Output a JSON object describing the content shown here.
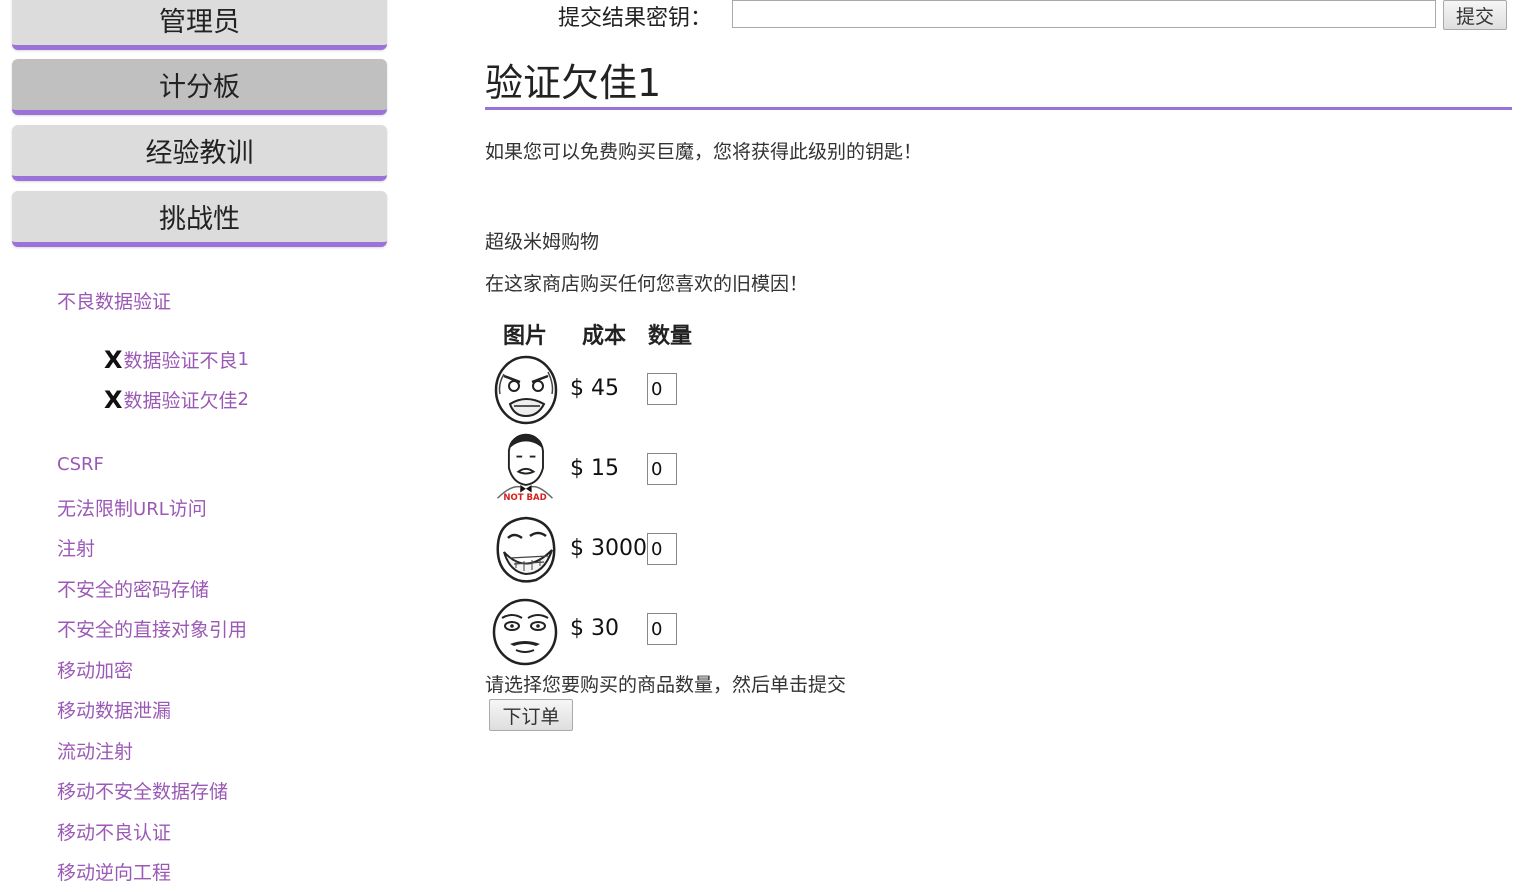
{
  "nav": {
    "buttons": [
      {
        "label": "管理员"
      },
      {
        "label": "计分板"
      },
      {
        "label": "经验教训"
      },
      {
        "label": "挑战性"
      }
    ]
  },
  "sidebar": {
    "category": "不良数据验证",
    "sub_items": [
      {
        "icon": "X",
        "label_cn": "数据验证不良",
        "label_num": "1"
      },
      {
        "icon": "X",
        "label_cn": "数据验证欠佳",
        "label_num": "2"
      }
    ],
    "links": [
      {
        "label": "CSRF"
      },
      {
        "label_pre": "无法限制",
        "label_latin": "URL",
        "label_post": "访问"
      },
      {
        "label": "注射"
      },
      {
        "label": "不安全的密码存储"
      },
      {
        "label": "不安全的直接对象引用"
      },
      {
        "label": "移动加密"
      },
      {
        "label": "移动数据泄漏"
      },
      {
        "label": "流动注射"
      },
      {
        "label": "移动不安全数据存储"
      },
      {
        "label": "移动不良认证"
      },
      {
        "label": "移动逆向工程"
      }
    ]
  },
  "key_bar": {
    "label": "提交结果密钥：",
    "value": "",
    "submit_label": "提交"
  },
  "main": {
    "title": "验证欠佳1",
    "intro": "如果您可以免费购买巨魔，您将获得此级别的钥匙！",
    "shop_name": "超级米姆购物",
    "shop_desc": "在这家商店购买任何您喜欢的旧模因！",
    "table_headers": [
      "图片",
      "成本",
      "数量"
    ],
    "items": [
      {
        "image": "rage-face",
        "price": "$ 45",
        "qty": "0"
      },
      {
        "image": "not-bad-face",
        "price": "$ 15",
        "qty": "0",
        "image_caption": "NOT BAD"
      },
      {
        "image": "troll-face",
        "price": "$ 3000",
        "qty": "0"
      },
      {
        "image": "me-gusta-face",
        "price": "$ 30",
        "qty": "0"
      }
    ],
    "instruction": "请选择您要购买的商品数量，然后单击提交",
    "order_button": "下订单"
  },
  "colors": {
    "accent": "#9b72d8",
    "link": "#9b59b6"
  }
}
